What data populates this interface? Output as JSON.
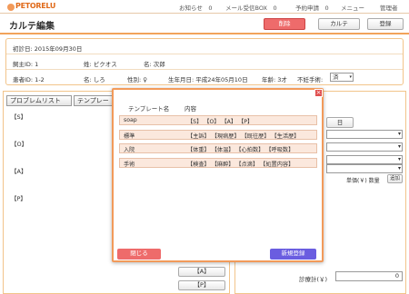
{
  "header": {
    "logo": "PETORELU",
    "nav": [
      {
        "label": "お知らせ",
        "count": "0"
      },
      {
        "label": "メール受信BOX",
        "count": "0"
      },
      {
        "label": "予約申請",
        "count": "0"
      },
      {
        "label": "メニュー"
      },
      {
        "label": "管理者"
      }
    ]
  },
  "title": {
    "text": "カルテ編集",
    "delete": "削除",
    "karte": "カルテ",
    "register": "登録"
  },
  "info": {
    "first_visit": "初診日: 2015年09月30日",
    "owner_id": "飼主ID: 1",
    "surname": "姓: ピクオス",
    "given_name": "名: 次郎",
    "pet_id": "患者ID: 1-2",
    "pet_name": "名: しろ",
    "sex": "性別: ♀",
    "birthday": "生年月日: 平成24年05月10日",
    "age": "年齢: 3才",
    "neuter_label": "不妊手術:",
    "neuter_value": "済"
  },
  "left": {
    "tab_problem": "プロブレムリスト",
    "tab_template": "テンプレー",
    "soap": [
      "【S】",
      "【O】",
      "【A】",
      "【P】"
    ],
    "bottom_a": "【A】",
    "bottom_p": "【P】"
  },
  "right": {
    "day_button": "日",
    "price_label": "単価(￥) 数量",
    "add": "追加",
    "total_label": "診療計(￥)",
    "total_value": "0"
  },
  "modal": {
    "col_name": "テンプレート名",
    "col_content": "内容",
    "rows": [
      {
        "name": "soap",
        "content": "【S】 【O】 【A】 【P】"
      },
      {
        "name": "標準",
        "content": "【主訴】 【現病歴】 【既往歴】 【生活歴】"
      },
      {
        "name": "入院",
        "content": "【体重】 【体温】 【心拍数】 【呼吸数】"
      },
      {
        "name": "手術",
        "content": "【検査】 【麻酔】 【点滴】 【処置内容】"
      }
    ],
    "close": "閉じる",
    "new": "新規登録"
  },
  "colors": {
    "accent": "#f29a5a",
    "danger": "#ee6b6b",
    "primary": "#6a5de0"
  }
}
